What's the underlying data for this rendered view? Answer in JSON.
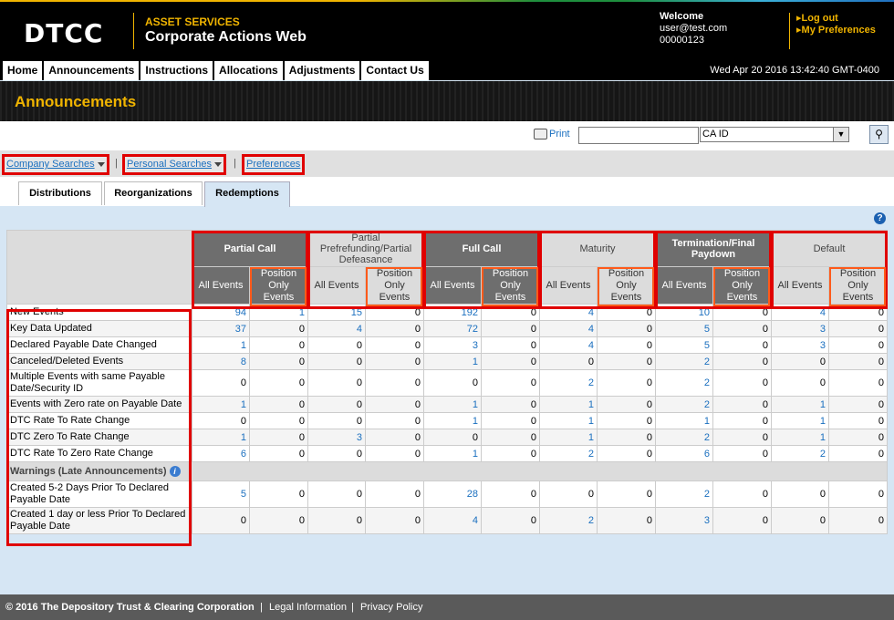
{
  "header": {
    "logo": "DTCC",
    "subtitle": "ASSET SERVICES",
    "title": "Corporate Actions Web",
    "welcome": "Welcome",
    "user_email": "user@test.com",
    "user_id": "00000123",
    "logout": "Log out",
    "preferences": "My Preferences"
  },
  "nav": {
    "items": [
      "Home",
      "Announcements",
      "Instructions",
      "Allocations",
      "Adjustments",
      "Contact Us"
    ],
    "datetime": "Wed Apr 20 2016 13:42:40 GMT-0400"
  },
  "banner": {
    "title": "Announcements"
  },
  "toolbar": {
    "print": "Print",
    "search_value": "",
    "search_type": "CA ID"
  },
  "links": {
    "company_searches": "Company Searches",
    "personal_searches": "Personal Searches",
    "preferences": "Preferences",
    "separator": "|"
  },
  "tabs": [
    "Distributions",
    "Reorganizations",
    "Redemptions"
  ],
  "active_tab": "Redemptions",
  "grid": {
    "groups": [
      "Partial Call",
      "Partial Prefrefunding/Partial Defeasance",
      "Full Call",
      "Maturity",
      "Termination/Final Paydown",
      "Default"
    ],
    "sub_all": "All Events",
    "sub_pos": "Position Only Events",
    "warnings_label": "Warnings (Late Announcements)",
    "rows": [
      {
        "label": "New Events",
        "values": [
          "94",
          "1",
          "15",
          "0",
          "192",
          "0",
          "4",
          "0",
          "10",
          "0",
          "4",
          "0"
        ]
      },
      {
        "label": "Key Data Updated",
        "values": [
          "37",
          "0",
          "4",
          "0",
          "72",
          "0",
          "4",
          "0",
          "5",
          "0",
          "3",
          "0"
        ]
      },
      {
        "label": "Declared Payable Date Changed",
        "values": [
          "1",
          "0",
          "0",
          "0",
          "3",
          "0",
          "4",
          "0",
          "5",
          "0",
          "3",
          "0"
        ]
      },
      {
        "label": "Canceled/Deleted Events",
        "values": [
          "8",
          "0",
          "0",
          "0",
          "1",
          "0",
          "0",
          "0",
          "2",
          "0",
          "0",
          "0"
        ]
      },
      {
        "label": "Multiple Events with same Payable Date/Security ID",
        "values": [
          "0",
          "0",
          "0",
          "0",
          "0",
          "0",
          "2",
          "0",
          "2",
          "0",
          "0",
          "0"
        ]
      },
      {
        "label": "Events with Zero rate on Payable Date",
        "values": [
          "1",
          "0",
          "0",
          "0",
          "1",
          "0",
          "1",
          "0",
          "2",
          "0",
          "1",
          "0"
        ]
      },
      {
        "label": "DTC Rate To Rate Change",
        "values": [
          "0",
          "0",
          "0",
          "0",
          "1",
          "0",
          "1",
          "0",
          "1",
          "0",
          "1",
          "0"
        ]
      },
      {
        "label": "DTC Zero To Rate Change",
        "values": [
          "1",
          "0",
          "3",
          "0",
          "0",
          "0",
          "1",
          "0",
          "2",
          "0",
          "1",
          "0"
        ]
      },
      {
        "label": "DTC Rate To Zero Rate Change",
        "values": [
          "6",
          "0",
          "0",
          "0",
          "1",
          "0",
          "2",
          "0",
          "6",
          "0",
          "2",
          "0"
        ]
      }
    ],
    "warning_rows": [
      {
        "label": "Created 5-2 Days Prior To Declared Payable Date",
        "values": [
          "5",
          "0",
          "0",
          "0",
          "28",
          "0",
          "0",
          "0",
          "2",
          "0",
          "0",
          "0"
        ]
      },
      {
        "label": "Created 1 day or less Prior To Declared Payable Date",
        "values": [
          "0",
          "0",
          "0",
          "0",
          "4",
          "0",
          "2",
          "0",
          "3",
          "0",
          "0",
          "0"
        ]
      }
    ]
  },
  "footer": {
    "copyright": "© 2016 The Depository Trust & Clearing Corporation",
    "legal": "Legal Information",
    "privacy": "Privacy Policy",
    "separator": "|"
  }
}
